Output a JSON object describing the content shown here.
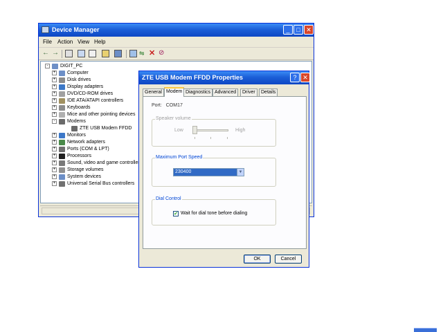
{
  "device_manager": {
    "title": "Device Manager",
    "menu": [
      "File",
      "Action",
      "View",
      "Help"
    ],
    "tree": [
      {
        "label": "DIGIT_PC",
        "level": 0,
        "expander": "-",
        "icon": "computer-icon",
        "color": "#6d8fc7"
      },
      {
        "label": "Computer",
        "level": 1,
        "expander": "+",
        "icon": "computer-icon",
        "color": "#6d8fc7"
      },
      {
        "label": "Disk drives",
        "level": 1,
        "expander": "+",
        "icon": "disk-drive-icon",
        "color": "#8c8c8c"
      },
      {
        "label": "Display adapters",
        "level": 1,
        "expander": "+",
        "icon": "display-adapter-icon",
        "color": "#3c78c8"
      },
      {
        "label": "DVD/CD-ROM drives",
        "level": 1,
        "expander": "+",
        "icon": "cdrom-icon",
        "color": "#a0a0a0"
      },
      {
        "label": "IDE ATA/ATAPI controllers",
        "level": 1,
        "expander": "+",
        "icon": "ide-controller-icon",
        "color": "#a09060"
      },
      {
        "label": "Keyboards",
        "level": 1,
        "expander": "+",
        "icon": "keyboard-icon",
        "color": "#8c8c8c"
      },
      {
        "label": "Mice and other pointing devices",
        "level": 1,
        "expander": "+",
        "icon": "mouse-icon",
        "color": "#b0b0b0"
      },
      {
        "label": "Modems",
        "level": 1,
        "expander": "-",
        "icon": "modem-icon",
        "color": "#6a6a6a"
      },
      {
        "label": "ZTE USB Modem FFDD",
        "level": 2,
        "expander": "",
        "icon": "modem-icon",
        "color": "#6a6a6a"
      },
      {
        "label": "Monitors",
        "level": 1,
        "expander": "+",
        "icon": "monitor-icon",
        "color": "#3c78c8"
      },
      {
        "label": "Network adapters",
        "level": 1,
        "expander": "+",
        "icon": "network-adapter-icon",
        "color": "#4a8a4a"
      },
      {
        "label": "Ports (COM & LPT)",
        "level": 1,
        "expander": "+",
        "icon": "port-icon",
        "color": "#707070"
      },
      {
        "label": "Processors",
        "level": 1,
        "expander": "+",
        "icon": "processor-icon",
        "color": "#202020"
      },
      {
        "label": "Sound, video and game controllers",
        "level": 1,
        "expander": "+",
        "icon": "sound-icon",
        "color": "#7a7a7a"
      },
      {
        "label": "Storage volumes",
        "level": 1,
        "expander": "+",
        "icon": "storage-volume-icon",
        "color": "#909090"
      },
      {
        "label": "System devices",
        "level": 1,
        "expander": "+",
        "icon": "system-device-icon",
        "color": "#6d8fc7"
      },
      {
        "label": "Universal Serial Bus controllers",
        "level": 1,
        "expander": "+",
        "icon": "usb-icon",
        "color": "#707070"
      }
    ]
  },
  "dialog": {
    "title": "ZTE USB Modem FFDD Properties",
    "tabs": [
      "General",
      "Modem",
      "Diagnostics",
      "Advanced",
      "Driver",
      "Details"
    ],
    "active_tab": "Modem",
    "port_label": "Port:",
    "port_value": "COM17",
    "speaker_group": "Speaker volume",
    "speaker_low": "Low",
    "speaker_high": "High",
    "speed_group": "Maximum Port Speed",
    "speed_value": "230400",
    "dial_group": "Dial Control",
    "dial_checkbox_label": "Wait for dial tone before dialing",
    "dial_checked": true,
    "ok_label": "OK",
    "cancel_label": "Cancel"
  },
  "colors": {
    "titlebar": "#1c5fd8",
    "window_bg": "#ece9d8",
    "selection": "#316ac5",
    "tab_highlight": "#ffc83c"
  }
}
